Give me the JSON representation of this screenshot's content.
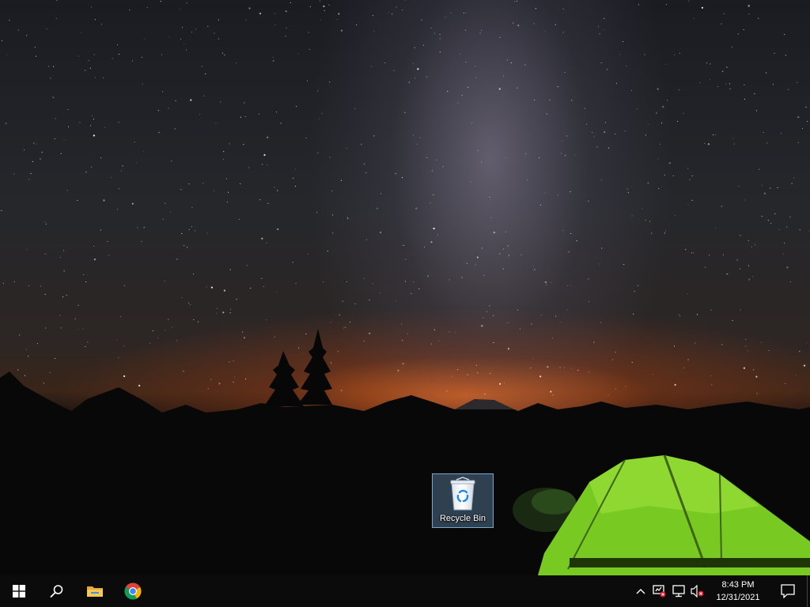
{
  "desktop": {
    "wallpaper": "starry-night-camping-tent",
    "icons": [
      {
        "label": "Recycle Bin",
        "icon": "recycle-bin-icon",
        "selected": true
      }
    ]
  },
  "taskbar": {
    "start": {
      "icon": "windows-logo-icon"
    },
    "search": {
      "icon": "search-icon"
    },
    "pinned": [
      {
        "name": "File Explorer",
        "icon": "folder-icon"
      },
      {
        "name": "Google Chrome",
        "icon": "chrome-icon"
      }
    ],
    "tray": {
      "icons": [
        "chevron-up-icon",
        "network-warning-icon",
        "ethernet-icon",
        "volume-muted-icon"
      ],
      "time": "8:43 PM",
      "date": "12/31/2021",
      "notifications_icon": "action-center-icon"
    }
  },
  "colors": {
    "taskbar_bg": "#0b0b0c",
    "selection_bg": "#78aad7",
    "tent_green": "#7ed321",
    "horizon_orange": "#e86820"
  }
}
